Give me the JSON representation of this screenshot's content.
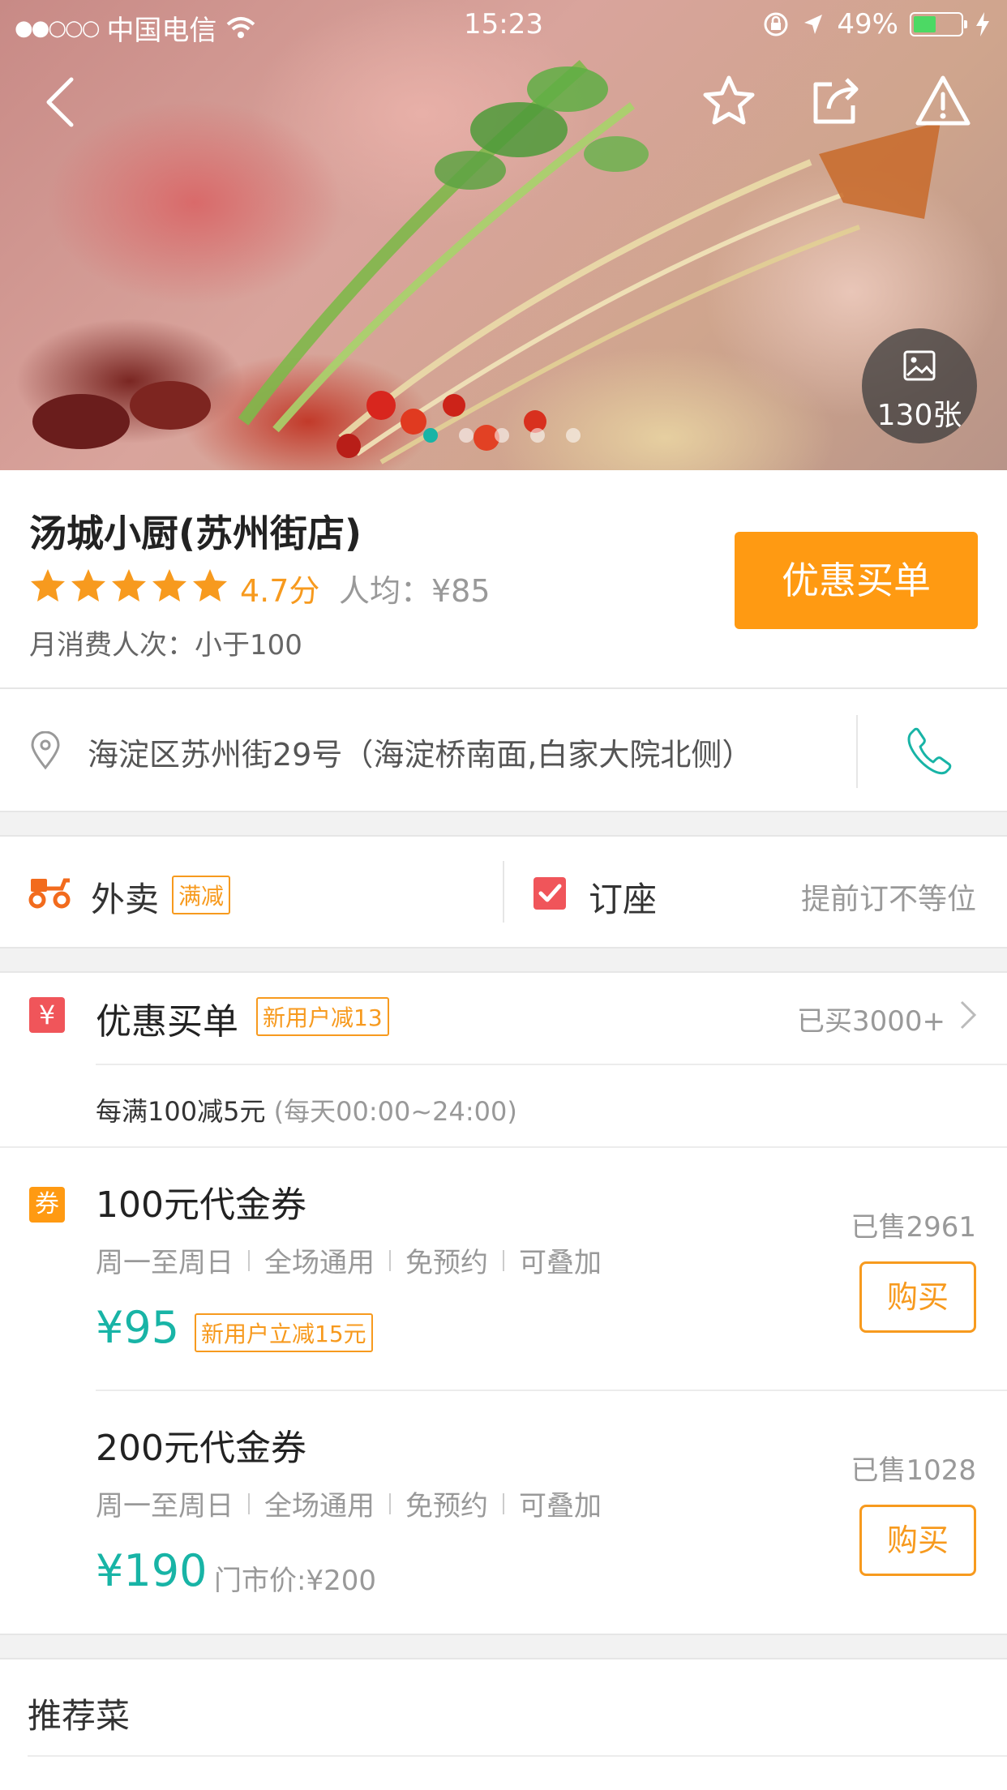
{
  "status_bar": {
    "carrier": "中国电信",
    "signal_dots": "●●○○○",
    "time": "15:23",
    "battery": "49%"
  },
  "hero": {
    "photo_count": "130张",
    "pager_total": 5,
    "pager_active": 0,
    "icons": [
      "back-icon",
      "star-icon",
      "share-icon",
      "warning-icon"
    ]
  },
  "shop": {
    "name": "汤城小厨(苏州街店)",
    "stars": 5,
    "rating": "4.7分",
    "avg_price": "人均：¥85",
    "monthly": "月消费人次：小于100",
    "pay_button": "优惠买单"
  },
  "address": {
    "text": "海淀区苏州街29号（海淀桥南面,白家大院北侧）"
  },
  "services": {
    "takeout_label": "外卖",
    "takeout_tag": "满减",
    "seat_label": "订座",
    "seat_note": "提前订不等位"
  },
  "discount": {
    "badge": "¥",
    "title": "优惠买单",
    "tag": "新用户减13",
    "bought": "已买3000+",
    "rule": "每满100减5元",
    "rule_time": "(每天00:00~24:00)"
  },
  "vouchers": {
    "badge": "券",
    "items": [
      {
        "title": "100元代金券",
        "meta": [
          "周一至周日",
          "全场通用",
          "免预约",
          "可叠加"
        ],
        "price": "¥95",
        "tag": "新用户立减15元",
        "sold": "已售2961",
        "button": "购买"
      },
      {
        "title": "200元代金券",
        "meta": [
          "周一至周日",
          "全场通用",
          "免预约",
          "可叠加"
        ],
        "price": "¥190",
        "original": "门市价:¥200",
        "sold": "已售1028",
        "button": "购买"
      }
    ]
  },
  "recommend": {
    "title": "推荐菜"
  },
  "colors": {
    "accent_orange": "#ff9a12",
    "teal": "#18b4a6",
    "red_badge": "#f0555a"
  }
}
